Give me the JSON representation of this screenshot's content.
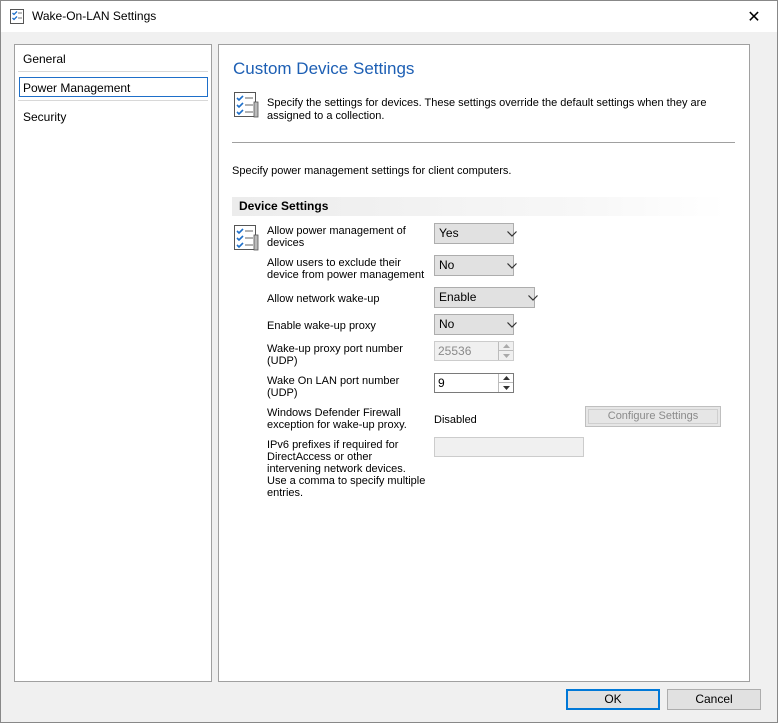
{
  "window": {
    "title": "Wake-On-LAN Settings",
    "close_glyph": "✕",
    "icon": "settings-checklist-icon"
  },
  "nav": {
    "items": [
      {
        "label": "General",
        "selected": false
      },
      {
        "label": "Power Management",
        "selected": true
      },
      {
        "label": "Security",
        "selected": false
      }
    ]
  },
  "content": {
    "title": "Custom Device Settings",
    "header_description": "Specify the settings for devices. These settings override the default settings when they are assigned to a collection.",
    "intro": "Specify power management settings for client computers.",
    "group_title": "Device Settings",
    "settings": {
      "allow_power_mgmt": {
        "label": "Allow power management of devices",
        "value": "Yes"
      },
      "allow_exclude": {
        "label": "Allow users to exclude their device from power management",
        "value": "No"
      },
      "network_wakeup": {
        "label": "Allow network wake-up",
        "value": "Enable"
      },
      "wakeup_proxy": {
        "label": "Enable wake-up proxy",
        "value": "No"
      },
      "proxy_port": {
        "label": "Wake-up proxy port number (UDP)",
        "value": "25536"
      },
      "wol_port": {
        "label": "Wake On LAN port number (UDP)",
        "value": "9"
      },
      "firewall": {
        "label": "Windows Defender Firewall exception for wake-up proxy.",
        "value": "Disabled",
        "button_label": "Configure Settings"
      },
      "ipv6": {
        "label": "IPv6 prefixes if required for DirectAccess or other intervening network devices. Use a comma to specify multiple entries.",
        "value": ""
      }
    }
  },
  "footer": {
    "ok_label": "OK",
    "cancel_label": "Cancel"
  },
  "colors": {
    "accent": "#1d5fb4",
    "selection_border": "#1e6fc9",
    "default_button": "#0078d7"
  }
}
